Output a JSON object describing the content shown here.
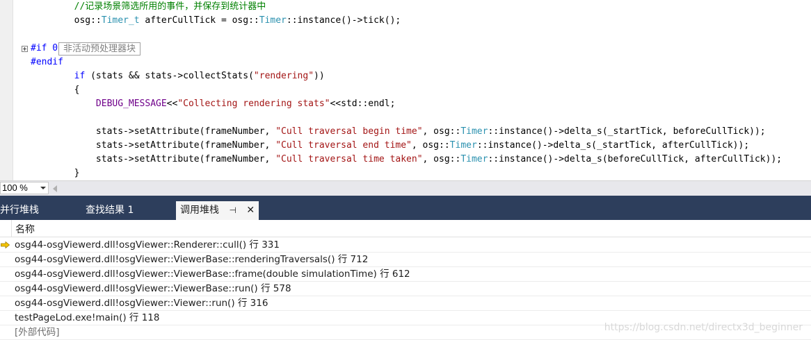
{
  "editor": {
    "lines": [
      {
        "parts": [
          {
            "t": "        ",
            "c": ""
          },
          {
            "t": "//记录场景筛选所用的事件，并保存到统计器中",
            "c": "cm"
          }
        ]
      },
      {
        "parts": [
          {
            "t": "        osg::",
            "c": ""
          },
          {
            "t": "Timer_t",
            "c": "ty"
          },
          {
            "t": " afterCullTick = osg::",
            "c": ""
          },
          {
            "t": "Timer",
            "c": "ty"
          },
          {
            "t": "::instance()->tick();",
            "c": ""
          }
        ]
      },
      {
        "parts": [
          {
            "t": "",
            "c": ""
          }
        ]
      },
      {
        "parts": [
          {
            "t": "#if 0",
            "c": "kw"
          }
        ]
      },
      {
        "parts": [
          {
            "t": "#endif",
            "c": "kw"
          }
        ]
      },
      {
        "parts": [
          {
            "t": "        ",
            "c": ""
          },
          {
            "t": "if",
            "c": "kw"
          },
          {
            "t": " (stats && stats->collectStats(",
            "c": ""
          },
          {
            "t": "\"rendering\"",
            "c": "st"
          },
          {
            "t": "))",
            "c": ""
          }
        ]
      },
      {
        "parts": [
          {
            "t": "        {",
            "c": ""
          }
        ]
      },
      {
        "parts": [
          {
            "t": "            ",
            "c": ""
          },
          {
            "t": "DEBUG_MESSAGE",
            "c": "mc"
          },
          {
            "t": "<<",
            "c": ""
          },
          {
            "t": "\"Collecting rendering stats\"",
            "c": "st"
          },
          {
            "t": "<<std::endl;",
            "c": ""
          }
        ]
      },
      {
        "parts": [
          {
            "t": "",
            "c": ""
          }
        ]
      },
      {
        "parts": [
          {
            "t": "            stats->setAttribute(frameNumber, ",
            "c": ""
          },
          {
            "t": "\"Cull traversal begin time\"",
            "c": "st"
          },
          {
            "t": ", osg::",
            "c": ""
          },
          {
            "t": "Timer",
            "c": "ty"
          },
          {
            "t": "::instance()->delta_s(_startTick, beforeCullTick));",
            "c": ""
          }
        ]
      },
      {
        "parts": [
          {
            "t": "            stats->setAttribute(frameNumber, ",
            "c": ""
          },
          {
            "t": "\"Cull traversal end time\"",
            "c": "st"
          },
          {
            "t": ", osg::",
            "c": ""
          },
          {
            "t": "Timer",
            "c": "ty"
          },
          {
            "t": "::instance()->delta_s(_startTick, afterCullTick));",
            "c": ""
          }
        ]
      },
      {
        "parts": [
          {
            "t": "            stats->setAttribute(frameNumber, ",
            "c": ""
          },
          {
            "t": "\"Cull traversal time taken\"",
            "c": "st"
          },
          {
            "t": ", osg::",
            "c": ""
          },
          {
            "t": "Timer",
            "c": "ty"
          },
          {
            "t": "::instance()->delta_s(beforeCullTick, afterCullTick));",
            "c": ""
          }
        ]
      },
      {
        "parts": [
          {
            "t": "        }",
            "c": ""
          }
        ]
      }
    ],
    "inactive_block_label": "非活动预处理器块"
  },
  "zoom": {
    "value": "100 %"
  },
  "tabs": [
    {
      "label": "并行堆栈",
      "active": false
    },
    {
      "label": "查找结果 1",
      "active": false
    },
    {
      "label": "调用堆栈",
      "active": true
    }
  ],
  "callstack": {
    "column_header": "名称",
    "rows": [
      {
        "text": "osg44-osgViewerd.dll!osgViewer::Renderer::cull() 行 331",
        "current": true
      },
      {
        "text": "osg44-osgViewerd.dll!osgViewer::ViewerBase::renderingTraversals() 行 712",
        "current": false
      },
      {
        "text": "osg44-osgViewerd.dll!osgViewer::ViewerBase::frame(double simulationTime) 行 612",
        "current": false
      },
      {
        "text": "osg44-osgViewerd.dll!osgViewer::ViewerBase::run() 行 578",
        "current": false
      },
      {
        "text": "osg44-osgViewerd.dll!osgViewer::Viewer::run() 行 316",
        "current": false
      },
      {
        "text": "testPageLod.exe!main() 行 118",
        "current": false
      },
      {
        "text": "[外部代码]",
        "current": false,
        "external": true
      }
    ],
    "watermark": "https://blog.csdn.net/directx3d_beginner"
  },
  "colors": {
    "tab_bar": "#2d3e5c",
    "keyword": "#0000ff",
    "type": "#2b91af",
    "string": "#a31515",
    "comment": "#008000",
    "macro": "#6f008a",
    "current_frame_arrow": "#f5c400"
  },
  "icons": {
    "collapse": "plus-box-icon",
    "current_frame": "yellow-arrow-icon",
    "pin": "pin-icon",
    "close": "close-icon"
  }
}
